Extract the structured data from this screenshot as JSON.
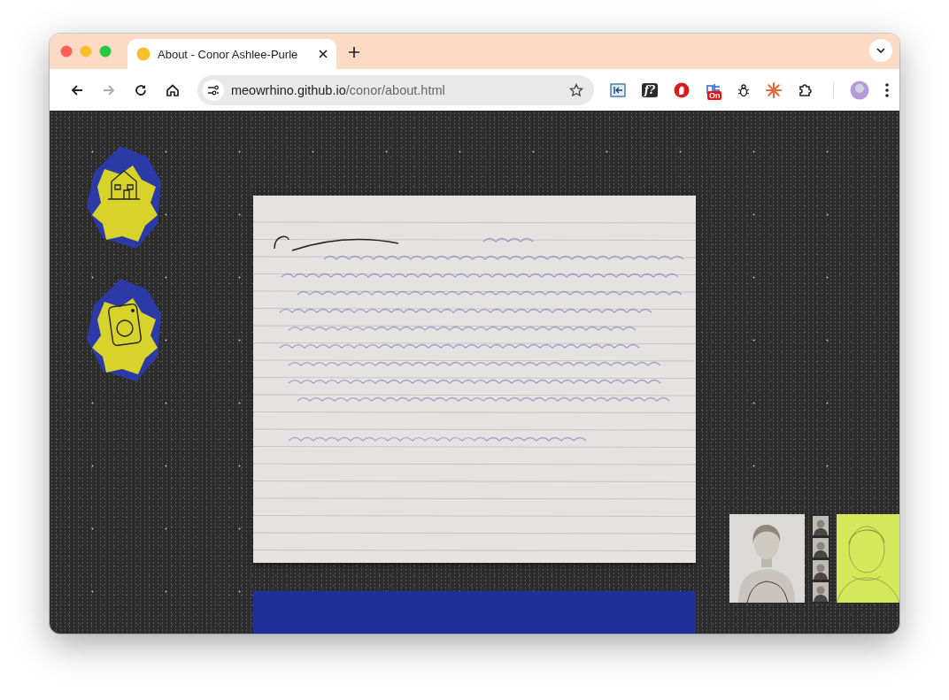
{
  "window": {
    "tab": {
      "title": "About - Conor Ashlee-Purle",
      "selected": true
    },
    "address": {
      "domain": "meowrhino.github.io",
      "path": "/conor/about.html"
    },
    "nav": {
      "forward_disabled": true
    },
    "extensions": [
      {
        "kind": "sidebar"
      },
      {
        "kind": "label",
        "label": "f?"
      },
      {
        "kind": "stop"
      },
      {
        "kind": "badge",
        "badge": "On"
      },
      {
        "kind": "bug"
      },
      {
        "kind": "burst"
      },
      {
        "kind": "puzzle"
      }
    ]
  },
  "page": {
    "nav_links": [
      {
        "kind": "home"
      },
      {
        "kind": "camera"
      }
    ],
    "photos": [
      {
        "kind": "portrait"
      },
      {
        "kind": "strip"
      },
      {
        "kind": "sketch"
      }
    ]
  }
}
